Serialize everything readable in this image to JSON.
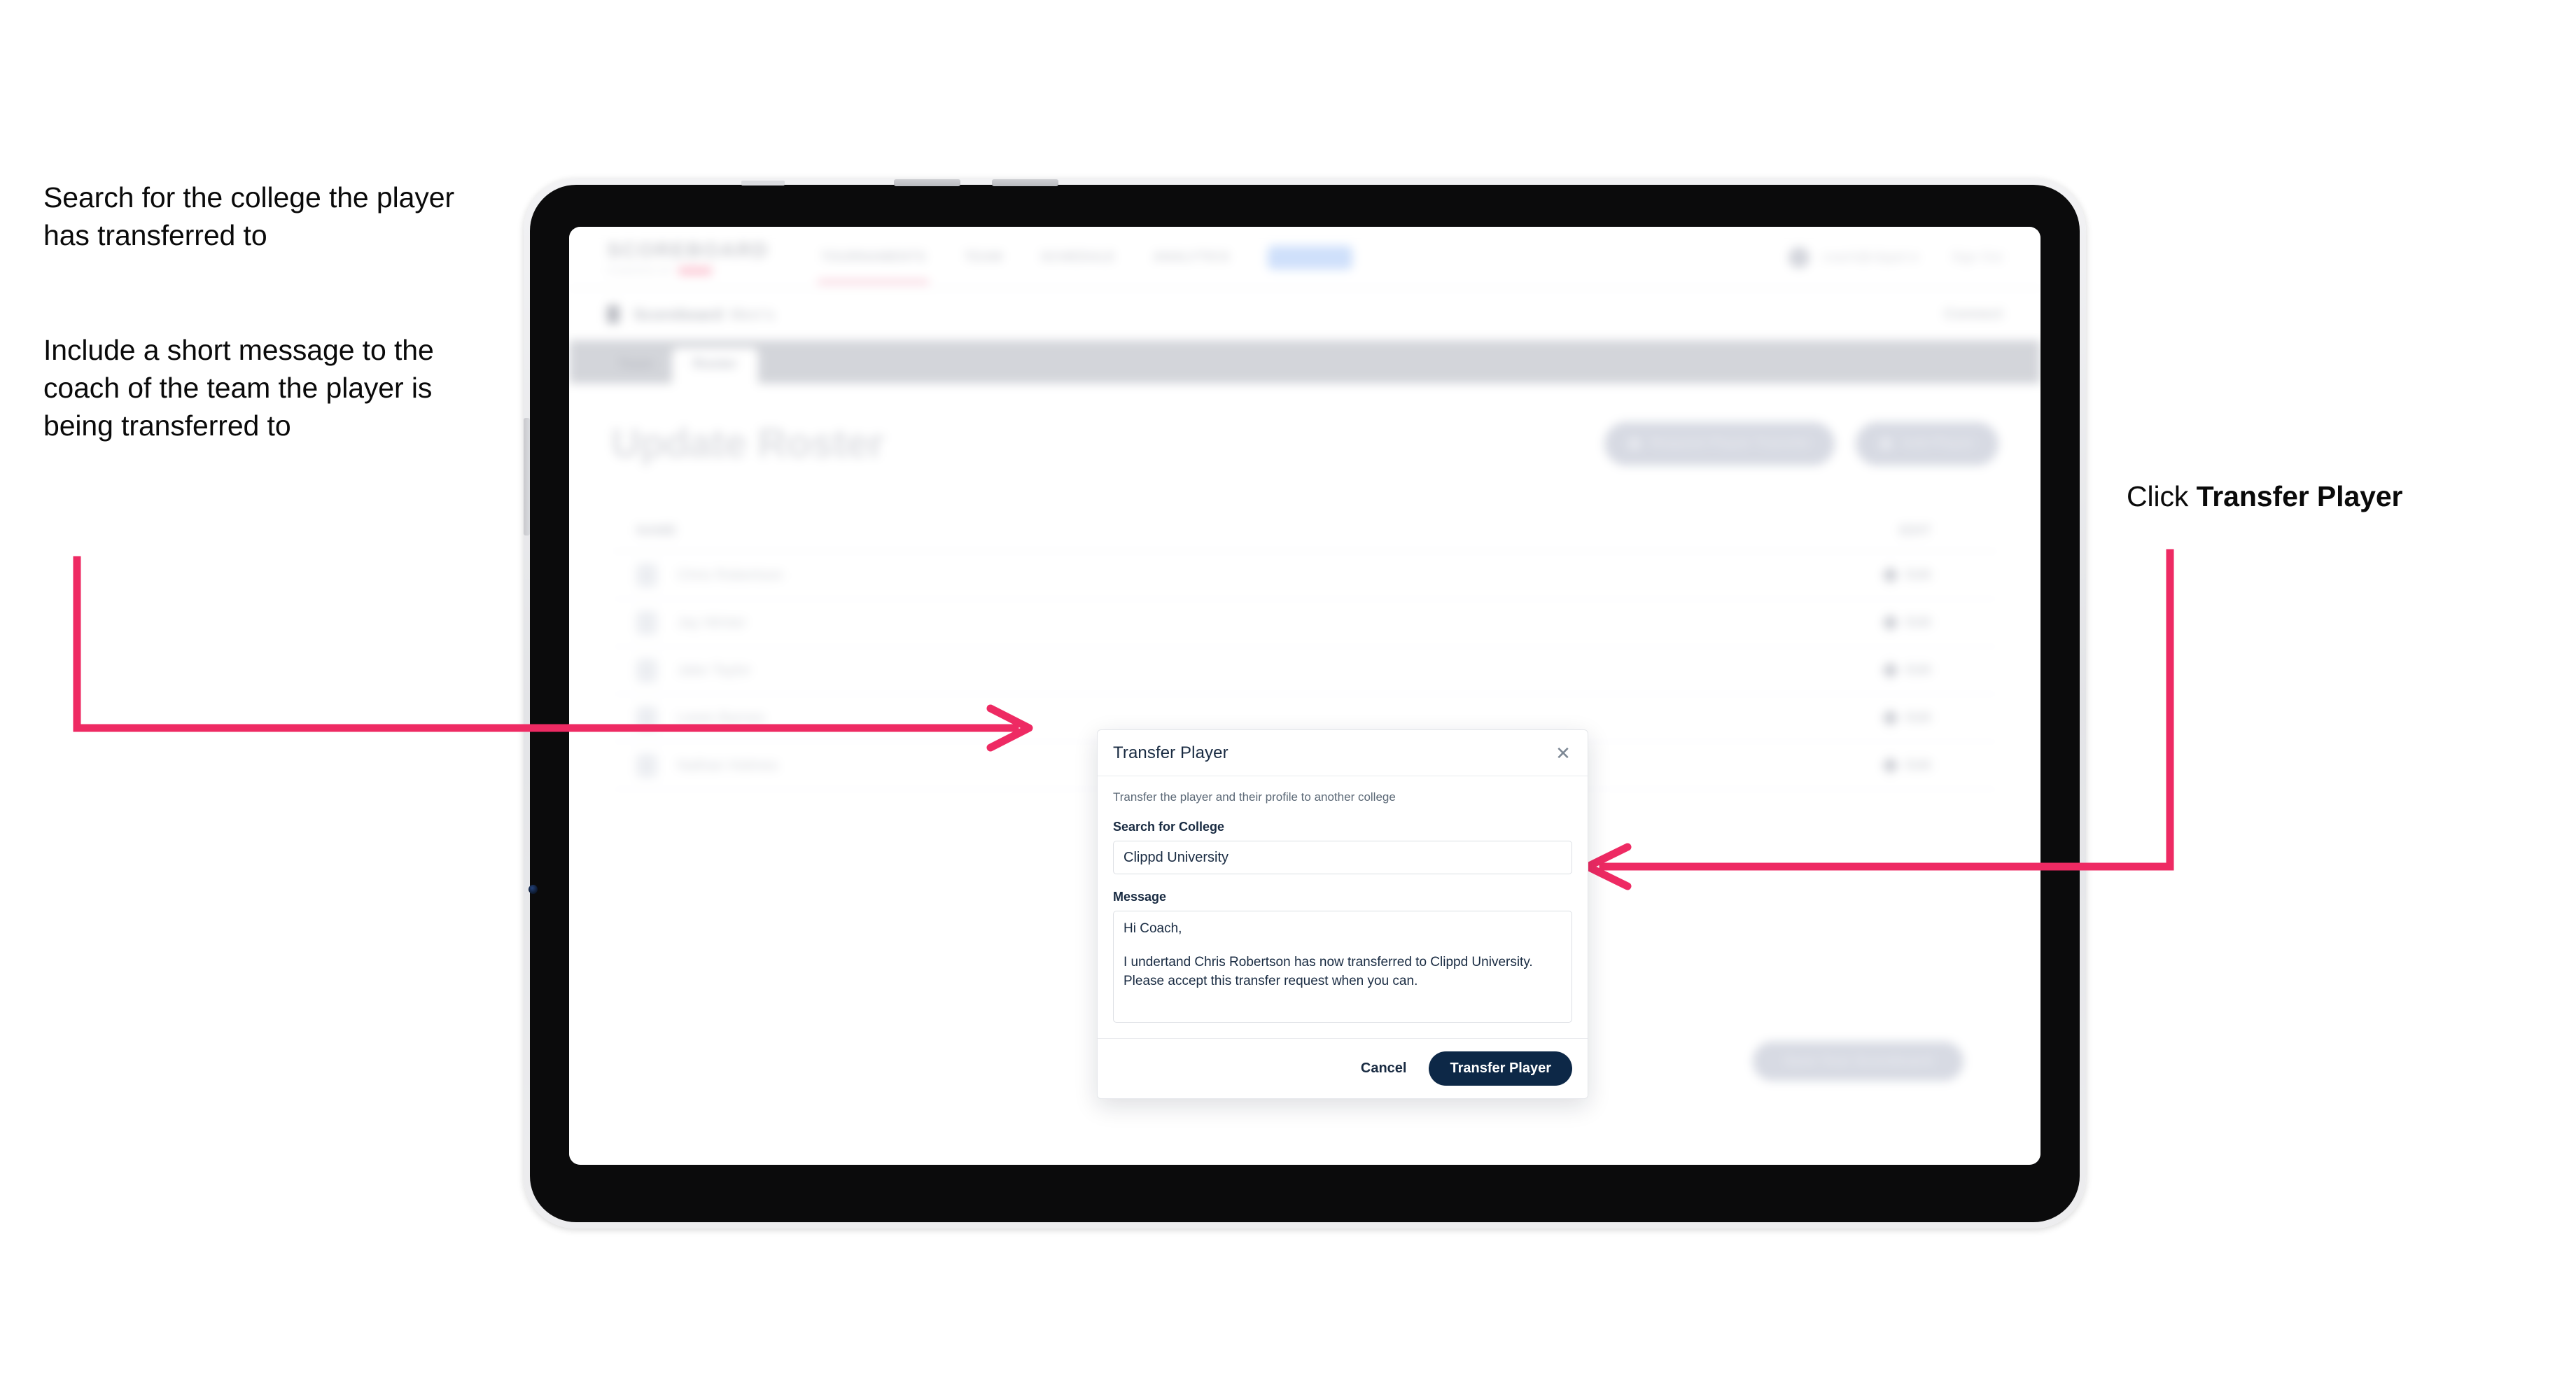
{
  "annotations": {
    "left_1": "Search for the college the player has transferred to",
    "left_2": "Include a short message to the coach of the team the player is being transferred to",
    "right_prefix": "Click ",
    "right_bold": "Transfer Player"
  },
  "colors": {
    "arrow": "#ee2a63",
    "primary_button": "#0d2847",
    "brand_accent": "#f04e79",
    "nav_chip": "#cfe0fb"
  },
  "app": {
    "logo": {
      "main": "SCOREBOARD",
      "sub": "POWERED BY",
      "sub_badge": "clippd"
    },
    "nav": [
      {
        "label": "TOURNAMENTS"
      },
      {
        "label": "TEAM"
      },
      {
        "label": "SCHEDULE"
      },
      {
        "label": "ANALYTICS"
      },
      {
        "label": "ROSTER"
      }
    ],
    "header_right": {
      "email": "coach@clippd.io",
      "sign_out": "Sign Out"
    },
    "breadcrumb": {
      "primary": "Scoreboard",
      "secondary": "Men's",
      "right_menu": "Connect"
    },
    "tabs": [
      {
        "label": "Team"
      },
      {
        "label": "Roster"
      }
    ],
    "page_title": "Update Roster",
    "page_actions": [
      {
        "label": "Request Player Transfer"
      },
      {
        "label": "Add Player"
      }
    ],
    "list": {
      "col_name": "NAME",
      "col_edit": "EDIT",
      "rows": [
        {
          "name": "Chris Robertson",
          "edit": "Edit"
        },
        {
          "name": "Jay Winter",
          "edit": "Edit"
        },
        {
          "name": "Jake Taylor",
          "edit": "Edit"
        },
        {
          "name": "Lewis Barnes",
          "edit": "Edit"
        },
        {
          "name": "Nathan Holmes",
          "edit": "Edit"
        }
      ]
    },
    "save_button": "Save Your Scoreboard"
  },
  "modal": {
    "title": "Transfer Player",
    "close_icon": "close-icon",
    "subtitle": "Transfer the player and their profile to another college",
    "college_label": "Search for College",
    "college_value": "Clippd University",
    "college_placeholder": "Search for College",
    "message_label": "Message",
    "message_line_1": "Hi Coach,",
    "message_line_2": "I undertand Chris Robertson has now transferred to Clippd University.",
    "message_line_3": "Please accept this transfer request when you can.",
    "cancel_label": "Cancel",
    "submit_label": "Transfer Player"
  }
}
